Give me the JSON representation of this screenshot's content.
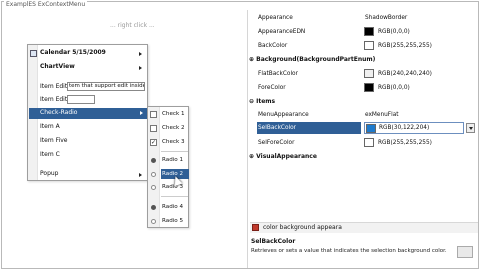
{
  "window": {
    "title": "ExamplES ExContextMenu"
  },
  "hint": "... right click ...",
  "menu": {
    "calendar": "Calendar 5/15/2009",
    "chartview": "ChartView",
    "item_edit_label": "Item Edit",
    "item_edit_value": "tem that support edit inside",
    "item_edit2_label": "Item Edit",
    "check_radio": "Check-Radio",
    "item_a": "Item A",
    "item_five": "Item Five",
    "item_c": "Item C",
    "popup": "Popup"
  },
  "submenu": {
    "check1": "Check 1",
    "check2": "Check 2",
    "check3": "Check 3",
    "radio1": "Radio 1",
    "radio2": "Radio 2",
    "radio3": "Radio 3",
    "radio4": "Radio 4",
    "radio5": "Radio 5"
  },
  "props": {
    "appearance": {
      "name": "Appearance",
      "value": "ShadowBorder"
    },
    "appearance_edn": {
      "name": "AppearanceEDN",
      "value": "RGB(0,0,0)",
      "color": "#000000"
    },
    "backcolor": {
      "name": "BackColor",
      "value": "RGB(255,255,255)",
      "color": "#ffffff"
    },
    "background_cat": "Background(BackgroundPartEnum)",
    "flatbackcolor": {
      "name": "FlatBackColor",
      "value": "RGB(240,240,240)",
      "color": "#f0f0f0"
    },
    "forecolor": {
      "name": "ForeColor",
      "value": "RGB(0,0,0)",
      "color": "#000000"
    },
    "items_cat": "Items",
    "menuappearance": {
      "name": "MenuAppearance",
      "value": "exMenuFlat"
    },
    "selbackcolor": {
      "name": "SelBackColor",
      "value": "RGB(30,122,204)",
      "color": "#1e7acc"
    },
    "selforecolor": {
      "name": "SelForeColor",
      "value": "RGB(255,255,255)",
      "color": "#ffffff"
    },
    "visual_cat": "VisualAppearance"
  },
  "help": {
    "title": "color background appeara",
    "name": "SelBackColor",
    "description": "Retrieves or sets a value that indicates the selection background color."
  },
  "colors": {
    "selection": "#2f5f96",
    "accent_icon": "#c0392b"
  }
}
